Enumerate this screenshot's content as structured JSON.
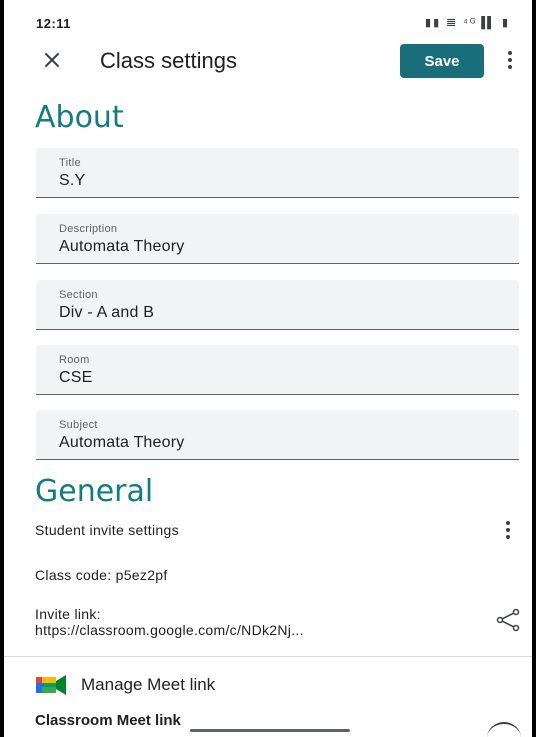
{
  "status_bar": {
    "time": "12:11",
    "icons_text": "▮▮ 𝌆 ⁴ᴳ▐▌ ▮"
  },
  "toolbar": {
    "title": "Class settings",
    "save_label": "Save",
    "close_icon": "close-icon",
    "more_icon": "more-vert-icon"
  },
  "about": {
    "heading": "About",
    "fields": [
      {
        "label": "Title",
        "value": "S.Y"
      },
      {
        "label": "Description",
        "value": "Automata Theory"
      },
      {
        "label": "Section",
        "value": "Div - A and B"
      },
      {
        "label": "Room",
        "value": "CSE"
      },
      {
        "label": "Subject",
        "value": "Automata Theory"
      }
    ]
  },
  "general": {
    "heading": "General",
    "student_invite_settings": "Student invite settings",
    "class_code": "Class code: p5ez2pf",
    "invite_link_label": "Invite link:",
    "invite_link_url": "https://classroom.google.com/c/NDk2Nj...",
    "share_icon": "share-icon",
    "manage_meet_link": "Manage Meet link",
    "meet_icon": "google-meet-icon",
    "classroom_meet_link": "Classroom Meet link"
  },
  "colors": {
    "accent": "#137b84",
    "save_button": "#1a6e7a",
    "field_background": "#f1f3f4"
  }
}
